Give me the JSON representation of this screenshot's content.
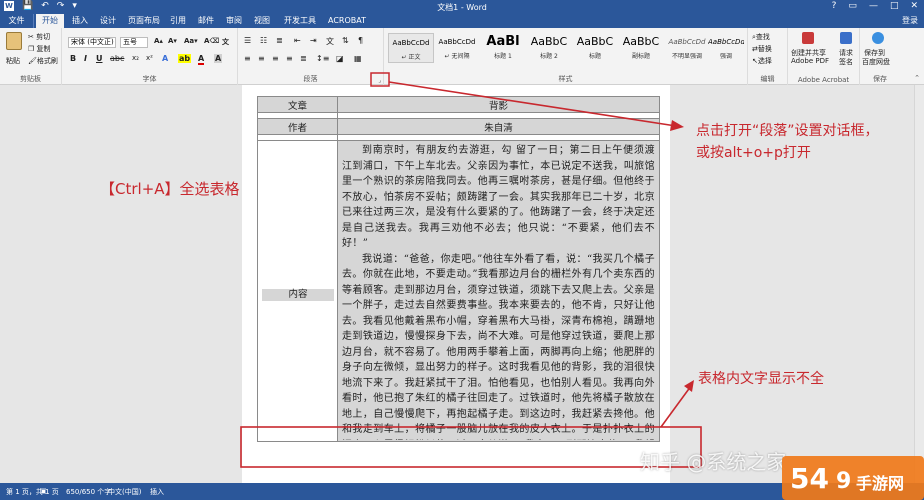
{
  "window": {
    "title": "文档1 - Word",
    "controls": [
      "?",
      "▭",
      "—",
      "□",
      "✕"
    ]
  },
  "tabs": {
    "file": "文件",
    "items": [
      "开始",
      "插入",
      "设计",
      "页面布局",
      "引用",
      "邮件",
      "审阅",
      "视图",
      "开发工具",
      "ACROBAT"
    ],
    "active": "开始",
    "login": "登录"
  },
  "ribbon": {
    "clipboard": {
      "paste": "粘贴",
      "cut": "剪切",
      "copy": "复制",
      "format_painter": "格式刷",
      "label": "剪贴板"
    },
    "font": {
      "name": "宋体 (中文正)",
      "size": "五号",
      "label": "字体"
    },
    "paragraph": {
      "label": "段落"
    },
    "styles": {
      "label": "样式",
      "items": [
        {
          "sample": "AaBbCcDd",
          "name": "↵ 正文"
        },
        {
          "sample": "AaBbCcDd",
          "name": "↵ 无间隔"
        },
        {
          "sample": "AaBl",
          "name": "标题 1"
        },
        {
          "sample": "AaBbC",
          "name": "标题 2"
        },
        {
          "sample": "AaBbC",
          "name": "标题"
        },
        {
          "sample": "AaBbC",
          "name": "副标题"
        },
        {
          "sample": "AaBbCcDd",
          "name": "不明显强调"
        },
        {
          "sample": "AaBbCcDd",
          "name": "强调"
        }
      ]
    },
    "editing": {
      "label": "编辑",
      "find": "查找",
      "replace": "替换",
      "select": "选择"
    },
    "acrobat": {
      "label": "Adobe Acrobat",
      "create_line1": "创建并共享",
      "create_line2": "Adobe PDF",
      "sign_line1": "请求",
      "sign_line2": "签名"
    },
    "save_cloud": {
      "label": "保存到",
      "line1": "保存到",
      "line2": "百度网盘",
      "group": "保存"
    }
  },
  "document": {
    "rows": [
      {
        "key": "文章",
        "value": "背影"
      },
      {
        "key": "作者",
        "value": "朱自清"
      }
    ],
    "content_label": "内容",
    "paragraphs": [
      "到南京时，有朋友约去游逛，勾 留了一日；第二日上午便须渡江到浦口，下午上车北去。父亲因为事忙，本已说定不送我，叫旅馆里一个熟识的茶房陪我同去。他再三嘱咐茶房，甚是仔细。但他终于不放心，怕茶房不妥帖；颇踌躇了一会。其实我那年已二十岁，北京已来往过两三次，是没有什么要紧的了。他踌躇了一会，终于决定还是自己送我去。我再三劝他不必去；他只说：“不要紧，他们去不好！”",
      "我说道：“爸爸，你走吧。”他往车外看了看，说：“我买几个橘子去。你就在此地，不要走动。”我看那边月台的栅栏外有几个卖东西的等着顾客。走到那边月台，须穿过铁道，须跳下去又爬上去。父亲是一个胖子，走过去自然要费事些。我本来要去的，他不肯，只好让他去。我看见他戴着黑布小帽，穿着黑布大马褂，深青布棉袍，蹒跚地走到铁道边，慢慢探身下去，尚不大难。可是他穿过铁道，要爬上那边月台，就不容易了。他用两手攀着上面，两脚再向上缩；他肥胖的身子向左微倾，显出努力的样子。这时我看见他的背影，我的泪很快地流下来了。我赶紧拭干了泪。怕他看见，也怕别人看见。我再向外看时，他已抱了朱红的橘子往回走了。过铁道时，他先将橘子散放在地上，自己慢慢爬下，再抱起橘子走。到这边时，我赶紧去搀他。他和我走到车上，将橘子一股脑儿放在我的皮大衣上。于是扑扑衣上的泥土，心里很轻松似的，过一会儿说：“我走了，到那边来信！”我望着他走出去。他走了几步，回过头看见我，说：“进去吧，里边没人。”等他的背影混入来来往往的人里，再找不着了，我便进来坐下，我的眼泪又来了。"
    ]
  },
  "annotations": {
    "ctrl_a": "【Ctrl+A】全选表格",
    "paragraph_dialog_line1": "点击打开“段落”设置对话框，",
    "paragraph_dialog_line2": "或按alt+o+p打开",
    "cut_off": "表格内文字显示不全",
    "watermark": "知乎 @系统之家",
    "logo": "手游网"
  },
  "statusbar": {
    "page": "第 1 页，共 1 页",
    "words": "650/650 个字",
    "language": "中文(中国)",
    "mode": "插入"
  },
  "colors": {
    "word_blue": "#2b579a",
    "annotation_red": "#c8282e",
    "table_shade": "#d6d6d6"
  }
}
